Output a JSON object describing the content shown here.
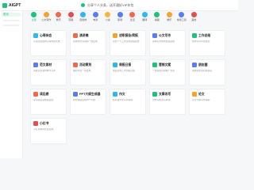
{
  "app": {
    "logo_text": "AIGPT"
  },
  "notice": {
    "text": "分享个人头条，送开通好VIP年包"
  },
  "sidebar": {
    "items": [
      {
        "label": "首页",
        "active": true
      },
      {
        "label": "",
        "active": false
      },
      {
        "label": "",
        "active": false
      }
    ]
  },
  "categories": [
    {
      "label": "全部",
      "icon": "grid-icon",
      "color": "#1ec27d",
      "active": true
    },
    {
      "label": "公文写作",
      "icon": "doc-icon",
      "color": "#f4a32c"
    },
    {
      "label": "教育",
      "icon": "book-icon",
      "color": "#f06a4a"
    },
    {
      "label": "营销",
      "icon": "megaphone-icon",
      "color": "#e04e4e"
    },
    {
      "label": "自媒体",
      "icon": "media-icon",
      "color": "#2fb5f0"
    },
    {
      "label": "电商",
      "icon": "cart-icon",
      "color": "#5a7cf2"
    },
    {
      "label": "小说",
      "icon": "pen-icon",
      "color": "#f7b53b"
    },
    {
      "label": "职场",
      "icon": "bag-icon",
      "color": "#5a7cf2"
    },
    {
      "label": "生活",
      "icon": "heart-icon",
      "color": "#f06a4a"
    },
    {
      "label": "翻译",
      "icon": "translate-icon",
      "color": "#2fb5f0"
    },
    {
      "label": "编程",
      "icon": "code-icon",
      "color": "#1ec27d"
    },
    {
      "label": "娱乐",
      "icon": "game-icon",
      "color": "#f4a32c"
    },
    {
      "label": "常用工具",
      "icon": "tool-icon",
      "color": "#5a7cf2"
    },
    {
      "label": "其他",
      "icon": "more-icon",
      "color": "#e04e4e"
    }
  ],
  "cards": [
    {
      "title": "心得体会",
      "desc": "写出高质量的心得体会文章",
      "icon": "heart-icon",
      "color": "#2fb5f0"
    },
    {
      "title": "演讲稿",
      "desc": "各类场合演讲稿一键生成",
      "icon": "mic-icon",
      "color": "#f06a4a"
    },
    {
      "title": "述职报告/简报",
      "desc": "总结个人工作生成述职报告",
      "icon": "report-icon",
      "color": "#f4a32c"
    },
    {
      "title": "公文写作",
      "desc": "多种公文格式快速完成",
      "icon": "doc-icon",
      "color": "#5a7cf2"
    },
    {
      "title": "工作总结",
      "desc": "帮你写好年终总结",
      "icon": "chart-icon",
      "color": "#1ec27d"
    },
    {
      "title": "范文素材",
      "desc": "海量范文素材参考写作",
      "icon": "book-icon",
      "color": "#5a7cf2"
    },
    {
      "title": "活动策划",
      "desc": "策划方案一键生成",
      "icon": "flag-icon",
      "color": "#f06a4a"
    },
    {
      "title": "周报日报",
      "desc": "快速生成工作周报日报",
      "icon": "calendar-icon",
      "color": "#2fb5f0"
    },
    {
      "title": "营销文案",
      "desc": "一键生成营销推广文案",
      "icon": "megaphone-icon",
      "color": "#1ec27d"
    },
    {
      "title": "朋友圈",
      "desc": "朋友圈文案轻松搞定",
      "icon": "camera-icon",
      "color": "#5a7cf2"
    },
    {
      "title": "读后感",
      "desc": "读书读后感快速生成",
      "icon": "read-icon",
      "color": "#f06a4a"
    },
    {
      "title": "PPT大纲生成器",
      "desc": "帮你快速生成PPT大纲",
      "icon": "ppt-icon",
      "color": "#5a7cf2"
    },
    {
      "title": "作文",
      "desc": "各年级作文写作辅导",
      "icon": "pen-icon",
      "color": "#2fb5f0"
    },
    {
      "title": "文章改写",
      "desc": "文章润色改写降重",
      "icon": "edit-icon",
      "color": "#1ec27d"
    },
    {
      "title": "论文",
      "desc": "论文大纲写作辅助",
      "icon": "paper-icon",
      "color": "#f4a32c"
    },
    {
      "title": "小红书",
      "desc": "小红书爆款文案生成",
      "icon": "star-icon",
      "color": "#e04e4e"
    }
  ]
}
